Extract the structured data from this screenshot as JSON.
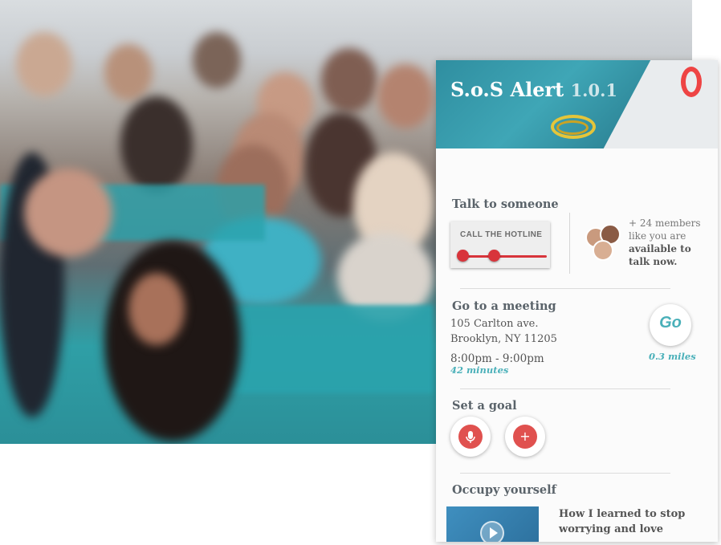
{
  "app": {
    "name": "S.o.S Alert",
    "version": "1.0.1"
  },
  "talk": {
    "heading": "Talk to someone",
    "hotline_label": "CALL THE HOTLINE",
    "members_count": "+ 24 members",
    "members_line2": "like you are",
    "members_bold1": "available to",
    "members_bold2": "talk now."
  },
  "meeting": {
    "heading": "Go to a meeting",
    "address1": "105 Carlton ave.",
    "address2": "Brooklyn, NY 11205",
    "time": "8:00pm - 9:00pm",
    "duration": "42 minutes",
    "go_label": "Go",
    "distance": "0.3 miles"
  },
  "goal": {
    "heading": "Set a goal",
    "mic_icon": "microphone-icon",
    "add_label": "+"
  },
  "occupy": {
    "heading": "Occupy yourself",
    "article_title": "How I learned to stop worrying and love recovery."
  },
  "colors": {
    "accent": "#4ab0b9",
    "red": "#e0514f"
  }
}
